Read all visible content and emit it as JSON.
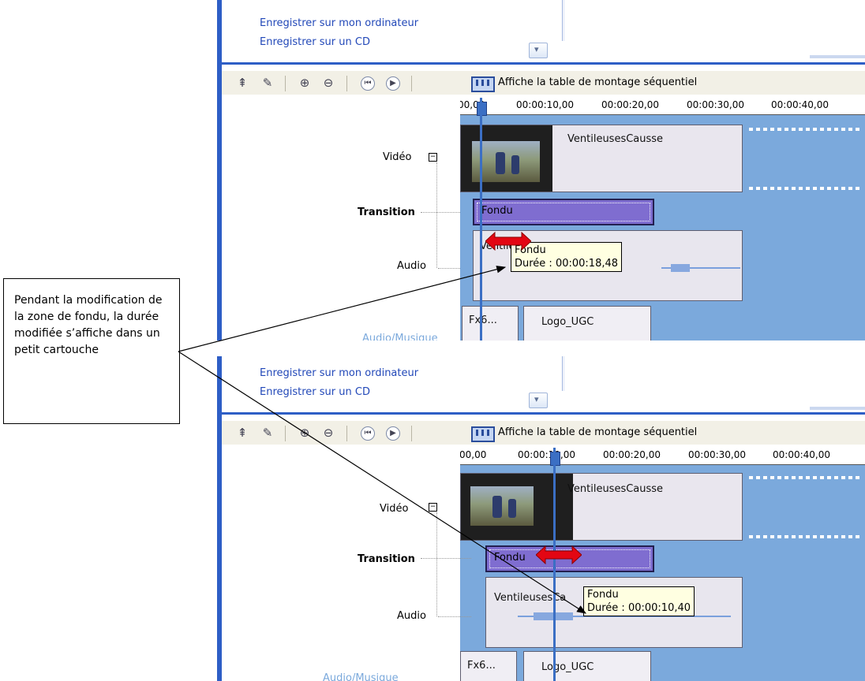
{
  "links": {
    "save_computer": "Enregistrer sur mon ordinateur",
    "save_cd": "Enregistrer sur un CD"
  },
  "toolbar": {
    "storyboard_label": "Affiche la table de montage séquentiel"
  },
  "timeline": {
    "top_ruler": [
      "00,00",
      "00:00:10,00",
      "00:00:20,00",
      "00:00:30,00",
      "00:00:40,00"
    ],
    "bottom_ruler": [
      "00,00",
      "00:00:10,00",
      "00:00:20,00",
      "00:00:30,00",
      "00:00:40,00"
    ]
  },
  "tracks": {
    "video": "Vidéo",
    "transition": "Transition",
    "audio": "Audio",
    "audio_music": "Audio/Musique"
  },
  "top_panel": {
    "video_clip_title": "VentileusesCausse",
    "transition_label": "Fondu",
    "audio_clip_title": "Ventileuse",
    "tooltip_title": "Fondu",
    "tooltip_duration": "Durée : 00:00:18,48",
    "music_clip_1": "Fx6...",
    "music_clip_2": "Logo_UGC"
  },
  "bottom_panel": {
    "video_clip_title": "VentileusesCausse",
    "transition_label": "Fondu",
    "audio_clip_title": "VentileusesCa",
    "tooltip_title": "Fondu",
    "tooltip_duration": "Durée : 00:00:10,40",
    "music_clip_1": "Fx6...",
    "music_clip_2": "Logo_UGC"
  },
  "callout": {
    "text": "Pendant la modification de la zone de fondu, la durée modifiée s’affiche dans un petit cartouche"
  },
  "colors": {
    "accent_blue": "#2e5ec6",
    "timeline_blue": "#7ba9dc",
    "transition_purple": "#7f6dd0",
    "arrow_red": "#e30613",
    "tooltip_bg": "#ffffe1"
  }
}
